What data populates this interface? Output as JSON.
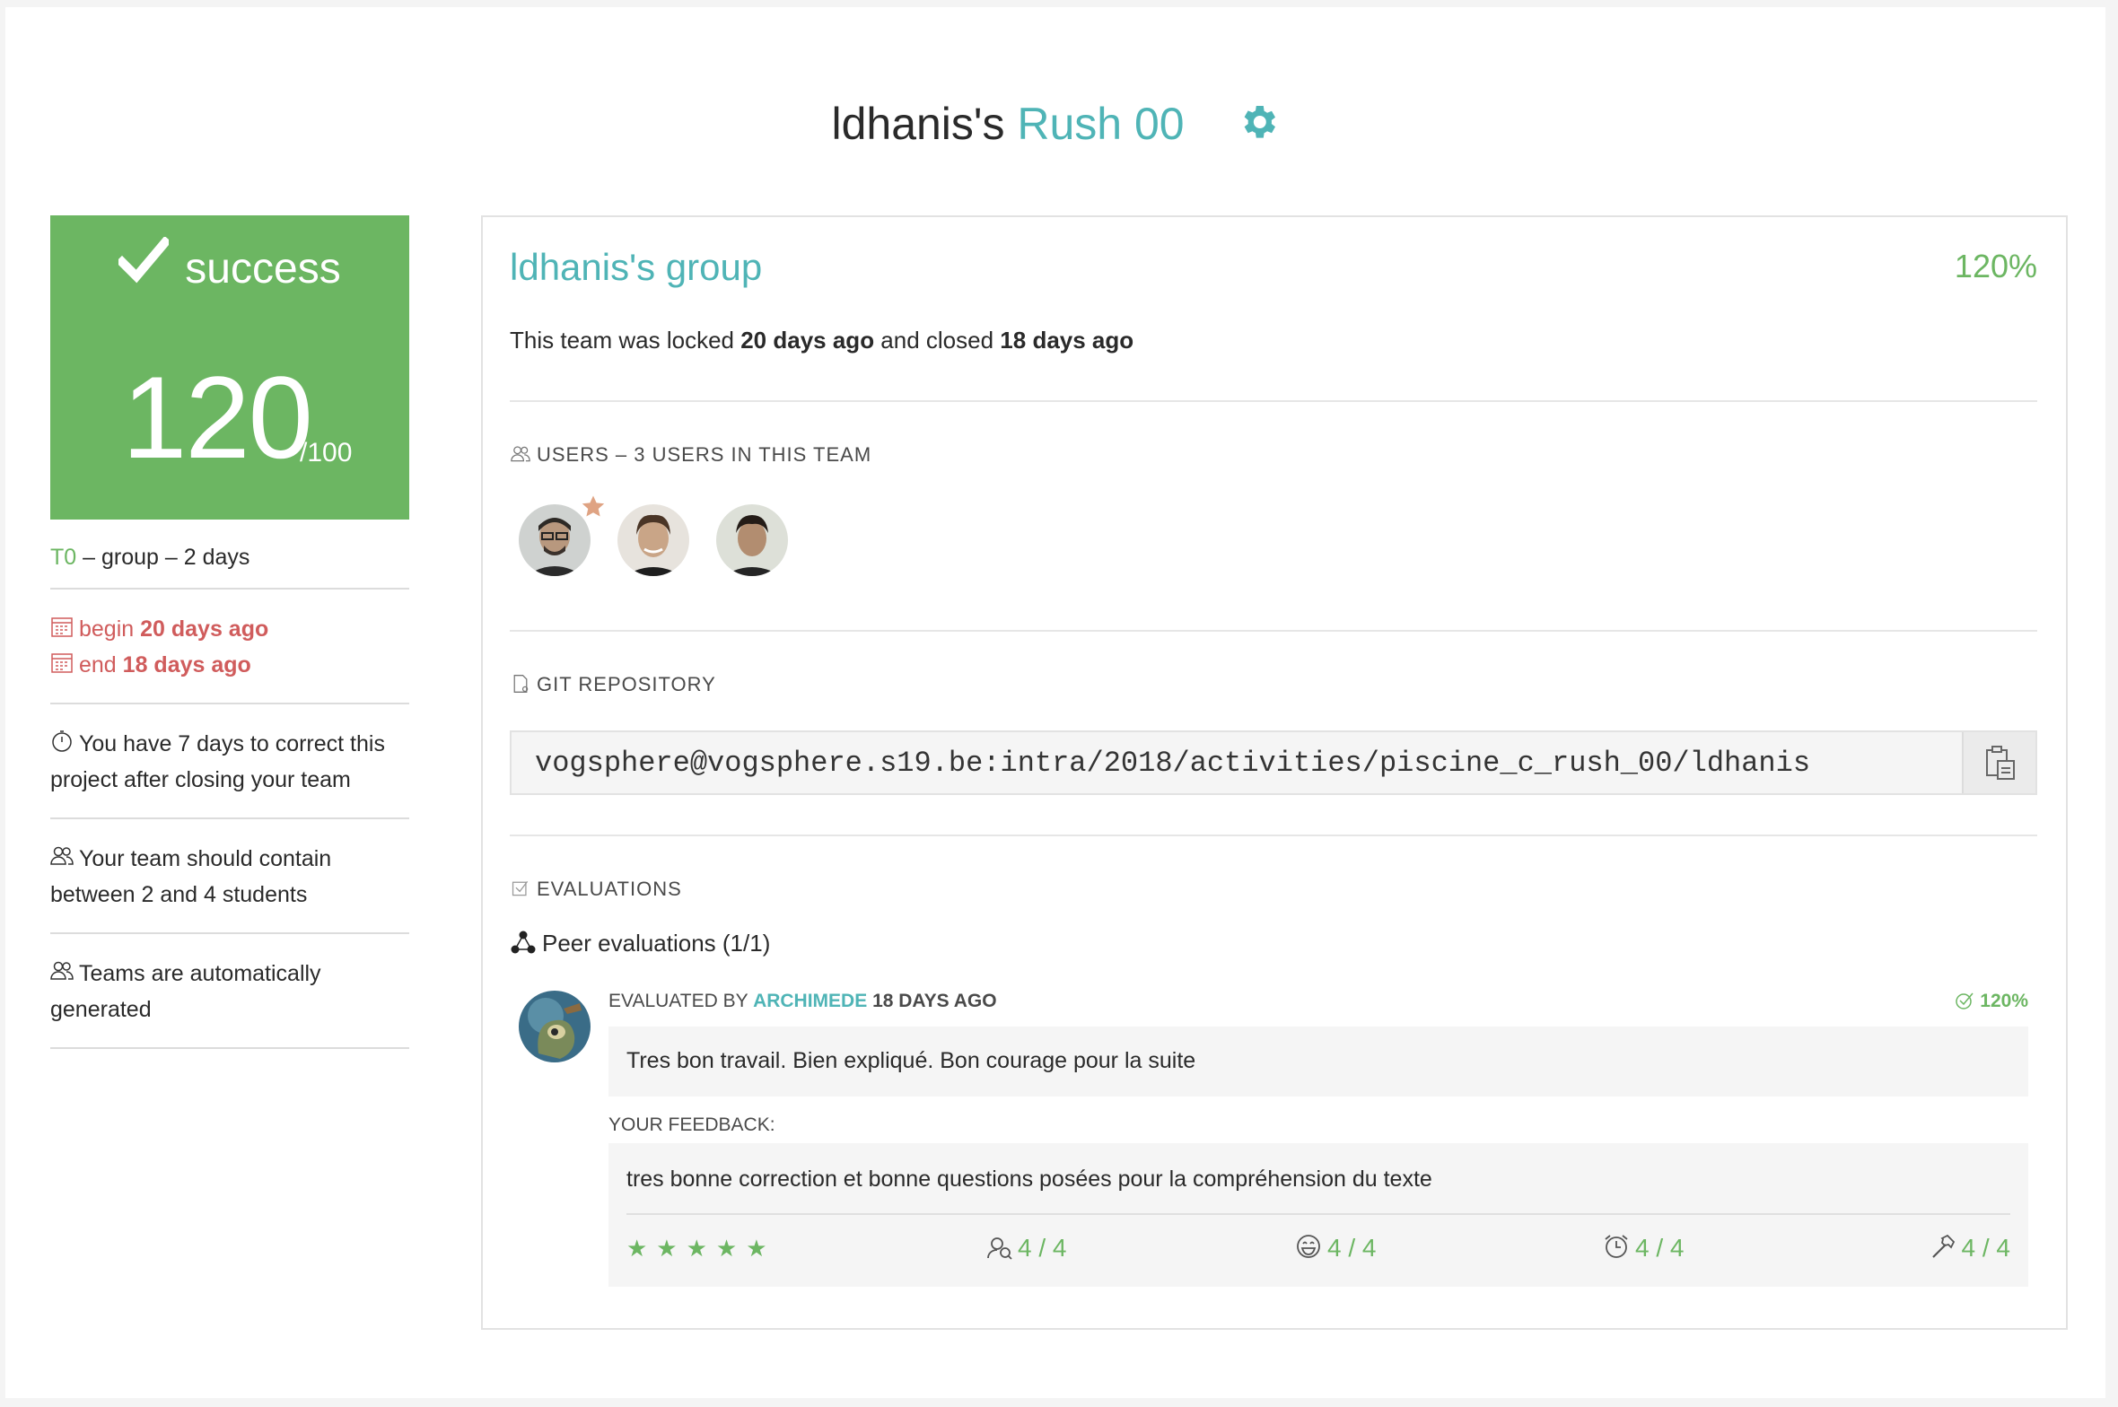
{
  "header": {
    "owner": "ldhanis's",
    "project": "Rush 00"
  },
  "mark": {
    "status": "success",
    "score": "120",
    "max": "/100"
  },
  "info": {
    "tier": "T0",
    "details": " – group – 2 days",
    "begin_label": "begin ",
    "begin_value": "20 days ago",
    "end_label": "end ",
    "end_value": "18 days ago",
    "correction": "You have 7 days to correct this project after closing your team",
    "team_size": "Your team should contain between 2 and 4 students",
    "auto": "Teams are automatically generated"
  },
  "team": {
    "name": "ldhanis's group",
    "final_mark": "120%",
    "locked_prefix": "This team was locked ",
    "locked_value": "20 days ago",
    "closed_prefix": " and closed ",
    "closed_value": "18 days ago",
    "users_label": "Users – 3 users in this team",
    "git_label": "Git repository",
    "repo_url": "vogsphere@vogsphere.s19.be:intra/2018/activities/piscine_c_rush_00/ldhanis",
    "evaluations_label": "Evaluations",
    "peer_title": "Peer evaluations (1/1)"
  },
  "evaluation": {
    "evaluated_by": "EVALUATED BY ",
    "evaluator": "ARCHIMEDE",
    "when": " 18 DAYS AGO",
    "mark": "120%",
    "comment": "Tres bon travail. Bien expliqué. Bon courage pour la suite",
    "feedback_label": "YOUR FEEDBACK:",
    "feedback": "tres bonne correction et bonne questions posées pour la compréhension du texte",
    "stars": "★★★★★",
    "ratings": {
      "interested": "4 / 4",
      "nice": "4 / 4",
      "punctuality": "4 / 4",
      "rigorous": "4 / 4"
    }
  },
  "colors": {
    "accent": "#4fb4b6",
    "success": "#6cb662",
    "danger": "#d05c5c"
  }
}
